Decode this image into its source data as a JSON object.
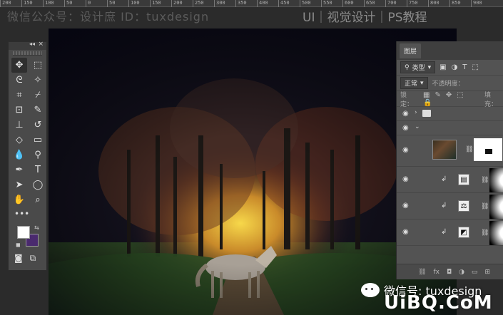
{
  "ruler": {
    "ticks": [
      "200",
      "150",
      "100",
      "50",
      "0",
      "50",
      "100",
      "150",
      "200",
      "250",
      "300",
      "350",
      "400",
      "450",
      "500",
      "550",
      "600",
      "650",
      "700",
      "750",
      "800",
      "850",
      "900"
    ]
  },
  "watermark": {
    "top_left": "微信公众号：设计庶 ID：tuxdesign",
    "top_right": "UI｜视觉设计｜PS教程",
    "wechat": "微信号: tuxdesign",
    "site": "UiBQ.CoM"
  },
  "toolbox": {
    "header_controls": [
      "◂◂",
      "×"
    ],
    "tools": [
      "move",
      "marquee",
      "lasso",
      "magic-wand",
      "crop",
      "eyedropper",
      "frame",
      "brush",
      "stamp",
      "history-brush",
      "eraser",
      "gradient",
      "blur",
      "dodge",
      "pen",
      "type",
      "path-select",
      "shape",
      "hand",
      "zoom"
    ],
    "more": "•••",
    "colors": {
      "foreground": "#ffffff",
      "background": "#4a2a6e"
    }
  },
  "layers": {
    "tab": "图层",
    "filter_label": "类型",
    "blend_mode": "正常",
    "opacity_label": "不透明度：",
    "lock_label": "锁定：",
    "fill_label": "填充："
  }
}
